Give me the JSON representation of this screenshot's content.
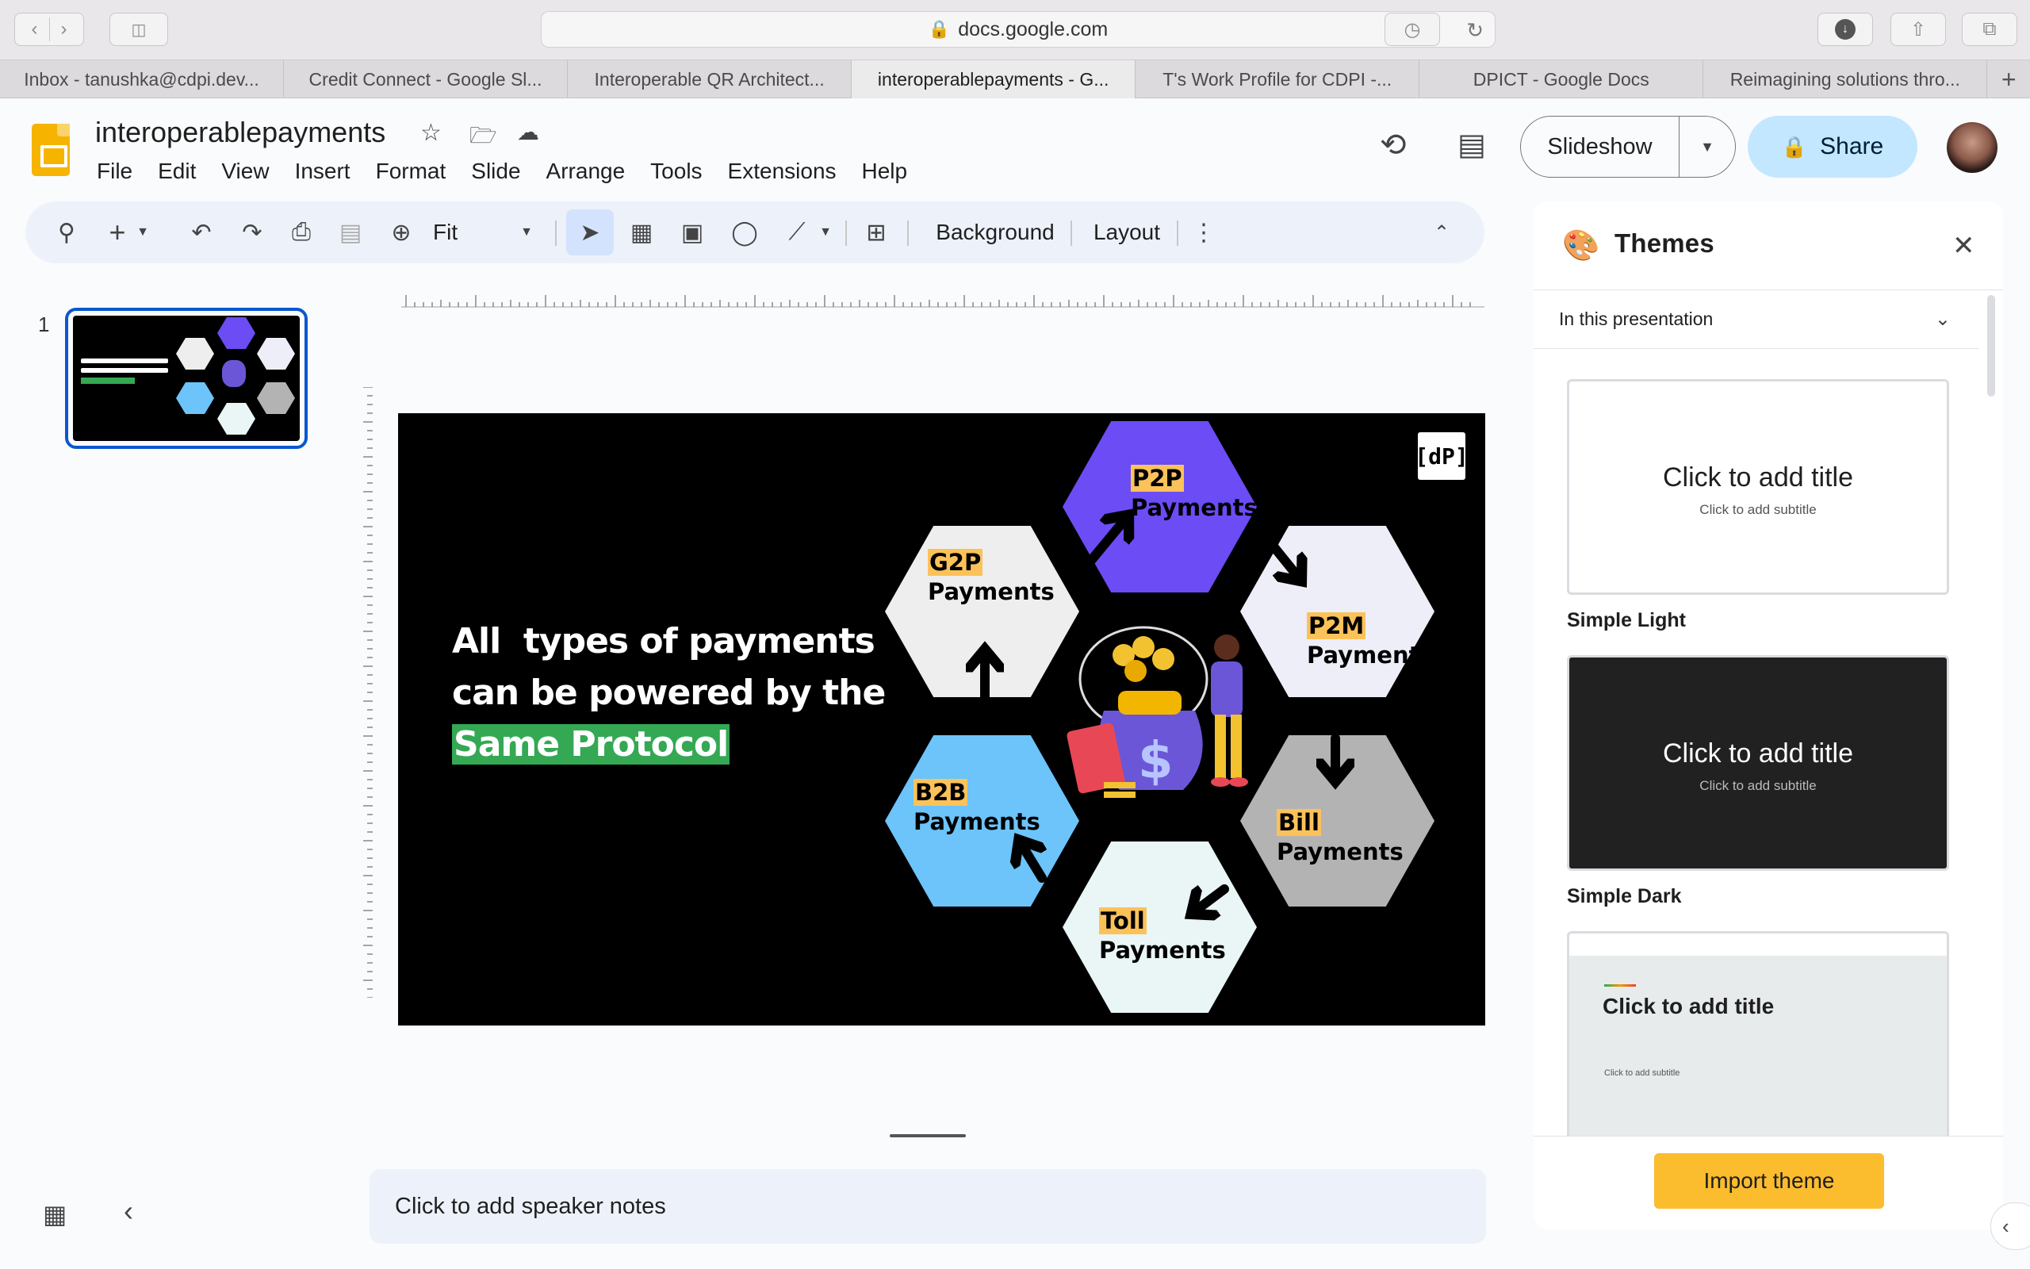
{
  "browser": {
    "url": "docs.google.com",
    "tabs": [
      {
        "label": "Inbox - tanushka@cdpi.dev..."
      },
      {
        "label": "Credit Connect - Google Sl..."
      },
      {
        "label": "Interoperable QR Architect..."
      },
      {
        "label": "interoperablepayments - G..."
      },
      {
        "label": "T's Work Profile for CDPI -..."
      },
      {
        "label": "DPICT - Google Docs"
      },
      {
        "label": "Reimagining solutions thro..."
      }
    ],
    "new_tab": "+"
  },
  "app": {
    "title": "interoperablepayments",
    "menu": [
      "File",
      "Edit",
      "View",
      "Insert",
      "Format",
      "Slide",
      "Arrange",
      "Tools",
      "Extensions",
      "Help"
    ],
    "slideshow_label": "Slideshow",
    "share_label": "Share"
  },
  "toolbar": {
    "zoom": "Fit",
    "background_label": "Background",
    "layout_label": "Layout"
  },
  "filmstrip": {
    "slide_number": "1"
  },
  "slide": {
    "headline_line1": "All  types of payments",
    "headline_line2": "can be powered by the",
    "headline_highlight": "Same Protocol",
    "hexagons": [
      {
        "key": "P2P",
        "label": "Payments",
        "color": "#6c4cf5"
      },
      {
        "key": "G2P",
        "label": "Payments",
        "color": "#eeeeee"
      },
      {
        "key": "P2M",
        "label": "Payments",
        "color": "#eeeef9"
      },
      {
        "key": "B2B",
        "label": "Payments",
        "color": "#6cc4fb"
      },
      {
        "key": "Bill",
        "label": "Payments",
        "color": "#b3b3b3"
      },
      {
        "key": "Toll",
        "label": "Payments",
        "color": "#eaf5f6"
      }
    ],
    "logo_text": "[dP]"
  },
  "notes": {
    "placeholder": "Click to add speaker notes"
  },
  "themes_panel": {
    "title": "Themes",
    "filter": "In this presentation",
    "themes": [
      {
        "name": "Simple Light",
        "title": "Click to add title",
        "subtitle": "Click to add subtitle"
      },
      {
        "name": "Simple Dark",
        "title": "Click to add title",
        "subtitle": "Click to add subtitle"
      },
      {
        "name": "",
        "title": "Click to add title",
        "subtitle": "Click to add subtitle"
      }
    ],
    "import_label": "Import theme"
  },
  "colors": {
    "accent": "#0b57d0",
    "share_bg": "#c2e7ff",
    "import_btn": "#fbbc2e",
    "slide_highlight": "#34a853",
    "hex_key_highlight": "#fbc25a"
  }
}
